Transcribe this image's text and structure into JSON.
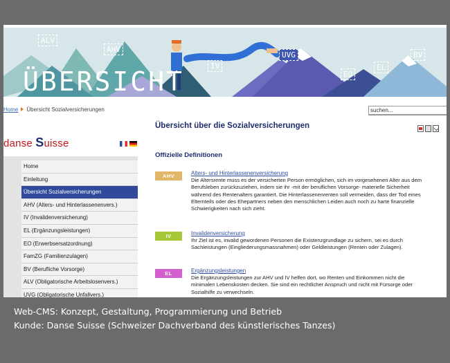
{
  "banner": {
    "title": "ÜBERSICHT",
    "tags": [
      "ALV",
      "AHV",
      "IV",
      "UVG",
      "EO",
      "EL",
      "BV"
    ]
  },
  "breadcrumb": {
    "home": "Home",
    "current": "Übersicht Sozialversicherungen"
  },
  "search": {
    "value": "suchen..."
  },
  "logo": {
    "part1": "danse ",
    "part2": "S",
    "part3": "uisse"
  },
  "sidebar": {
    "items": [
      {
        "label": "Home"
      },
      {
        "label": "Einleitung"
      },
      {
        "label": "Übersicht Sozialversicherungen",
        "active": true
      },
      {
        "label": "AHV (Alters- und Hinterlassenenvers.)"
      },
      {
        "label": "IV (Invalidenversicherung)"
      },
      {
        "label": "EL (Ergänzungsleistungen)"
      },
      {
        "label": "EO (Erwerbsersatzordnung)"
      },
      {
        "label": "FamZG (Familienzulagen)"
      },
      {
        "label": "BV (Berufliche Vorsorge)"
      },
      {
        "label": "ALV (Obligatorische Arbeitslosenvers.)"
      },
      {
        "label": "UVG (Obligatorische Unfallvers.)"
      }
    ]
  },
  "main": {
    "title": "Übersicht über die Sozialversicherungen",
    "section_title": "Offizielle Definitionen",
    "entries": [
      {
        "badge": "AHV",
        "color": "#e2b666",
        "title": "Alters- und Hinterlassenenversicherung",
        "text": "Die Altersrente muss es der versicherten Person ermöglichen, sich im vorgesehenen Alter aus dem Berufsleben zurückzuziehen, indem sie ihr -mit der beruflichen Vorsorge- materielle Sicherheit während des Rentenalters garantiert. Die Hinterlassenenrenten soll vermeiden, dass der Tod eines Elternteils oder des Ehepartners neben den menschlichen Leiden auch noch zu harte finanzielle Schwierigkeiten nach sich zieht."
      },
      {
        "badge": "IV",
        "color": "#a7c738",
        "title": "Invalidenversicherung",
        "text": "Ihr Ziel ist es, invalid gewordenen Personen die Existenzgrundlage zu sichern, sei es durch Sachleistungen (Eingliederungsmassnahmen) oder Geldleistungen (Renten oder Zulagen)."
      },
      {
        "badge": "EL",
        "color": "#d35fcf",
        "title": "Ergänzungsleistungen",
        "text": "Die Ergänzungsleistungen zur AHV und IV helfen dort, wo Renten und Einkommen nicht die minimalen Lebenskosten decken. Sie sind ein rechtlicher Anspruch und nicht mit Fürsorge oder Sozialhilfe zu verwechseln."
      }
    ]
  },
  "caption": {
    "line1": "Web-CMS: Konzept, Gestaltung, Programmierung und Betrieb",
    "line2": "Kunde: Danse Suisse (Schweizer Dachverband des künstlerisches Tanzes)"
  },
  "colors": {
    "nav_active": "#2f4a9a",
    "title_blue": "#1e2c6e",
    "link_blue": "#2a4ea0",
    "logo_red": "#c4141b"
  }
}
